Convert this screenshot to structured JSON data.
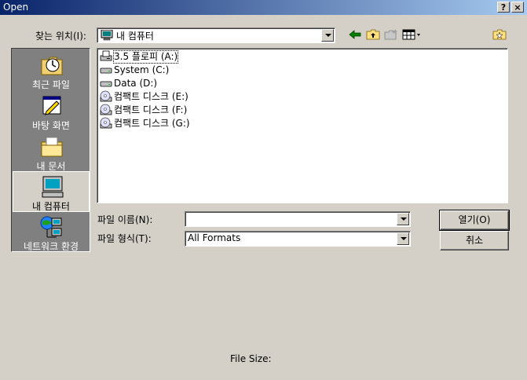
{
  "window": {
    "title": "Open",
    "help_label": "?",
    "close_label": "×"
  },
  "lookin": {
    "label": "찾는 위치(I):",
    "value": "내 컴퓨터"
  },
  "toolbar": {
    "icons": [
      "back-arrow-icon",
      "up-folder-icon",
      "new-folder-icon",
      "view-menu-icon",
      "preview-icon"
    ]
  },
  "places": [
    {
      "label": "최근 파일",
      "icon": "recent-files-icon",
      "selected": false
    },
    {
      "label": "바탕 화면",
      "icon": "desktop-icon",
      "selected": false
    },
    {
      "label": "내 문서",
      "icon": "my-documents-icon",
      "selected": false
    },
    {
      "label": "내 컴퓨터",
      "icon": "my-computer-icon",
      "selected": true
    },
    {
      "label": "네트워크 환경",
      "icon": "network-icon",
      "selected": false
    }
  ],
  "files": [
    {
      "name": "3.5 플로피 (A:)",
      "icon": "floppy-drive-icon"
    },
    {
      "name": "System (C:)",
      "icon": "hard-drive-icon"
    },
    {
      "name": "Data (D:)",
      "icon": "hard-drive-icon"
    },
    {
      "name": "컴팩트 디스크 (E:)",
      "icon": "cd-drive-icon"
    },
    {
      "name": "컴팩트 디스크 (F:)",
      "icon": "cd-drive-icon"
    },
    {
      "name": "컴팩트 디스크 (G:)",
      "icon": "cd-drive-icon"
    }
  ],
  "filename": {
    "label": "파일 이름(N):",
    "value": ""
  },
  "filetype": {
    "label": "파일 형식(T):",
    "value": "All Formats"
  },
  "buttons": {
    "open": "열기(O)",
    "cancel": "취소"
  },
  "status": {
    "file_size_label": "File Size:"
  }
}
